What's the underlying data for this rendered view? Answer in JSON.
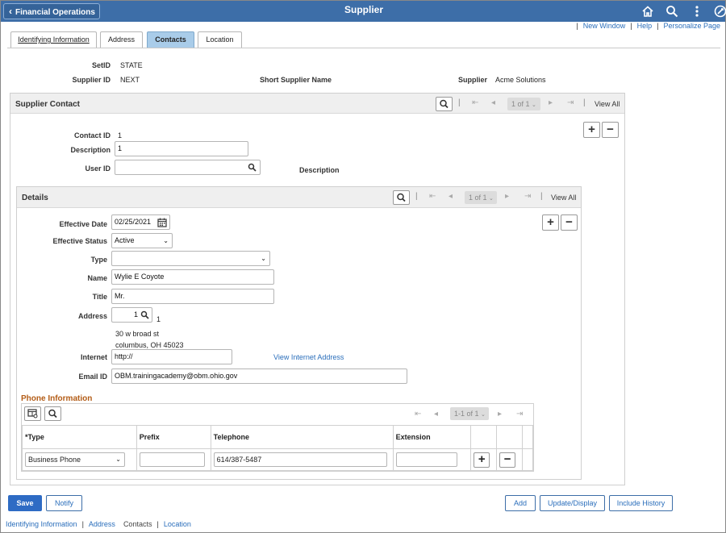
{
  "header": {
    "back_label": "Financial Operations",
    "title": "Supplier",
    "icons": [
      "home-icon",
      "search-icon",
      "more-icon",
      "navbar-icon"
    ]
  },
  "top_links": {
    "new_window": "New Window",
    "help": "Help",
    "personalize": "Personalize Page"
  },
  "tabs": [
    {
      "label": "Identifying Information",
      "active": false
    },
    {
      "label": "Address",
      "active": false
    },
    {
      "label": "Contacts",
      "active": true
    },
    {
      "label": "Location",
      "active": false
    }
  ],
  "summary": {
    "setid_label": "SetID",
    "setid_value": "STATE",
    "supplier_id_label": "Supplier ID",
    "supplier_id_value": "NEXT",
    "short_name_label": "Short Supplier Name",
    "supplier_label": "Supplier",
    "supplier_value": "Acme Solutions"
  },
  "supplier_contact": {
    "title": "Supplier Contact",
    "pager": "1 of 1",
    "view_all": "View All",
    "contact_id_label": "Contact ID",
    "contact_id_value": "1",
    "description_label": "Description",
    "description_value": "1",
    "user_id_label": "User ID",
    "user_id_value": "",
    "user_desc_label": "Description"
  },
  "details": {
    "title": "Details",
    "pager": "1 of 1",
    "view_all": "View All",
    "effective_date_label": "Effective Date",
    "effective_date_value": "02/25/2021",
    "effective_status_label": "Effective Status",
    "effective_status_value": "Active",
    "type_label": "Type",
    "type_value": "",
    "name_label": "Name",
    "name_value": "Wylie E Coyote",
    "title_label": "Title",
    "title_value": "Mr.",
    "address_label": "Address",
    "address_value": "1",
    "address_seq": "1",
    "address_line1": "30 w broad st",
    "address_line2": "columbus, OH  45023",
    "internet_label": "Internet",
    "internet_value": "http://",
    "view_internet": "View Internet Address",
    "email_label": "Email ID",
    "email_value": "OBM.trainingacademy@obm.ohio.gov"
  },
  "phone": {
    "title": "Phone Information",
    "pager": "1-1 of 1",
    "columns": {
      "type": "*Type",
      "prefix": "Prefix",
      "telephone": "Telephone",
      "extension": "Extension"
    },
    "rows": [
      {
        "type": "Business Phone",
        "prefix": "",
        "telephone": "614/387-5487",
        "extension": ""
      }
    ]
  },
  "footer_buttons": {
    "save": "Save",
    "notify": "Notify",
    "add": "Add",
    "update_display": "Update/Display",
    "include_history": "Include History"
  },
  "footer_links": [
    "Identifying Information",
    "Address",
    "Contacts",
    "Location"
  ]
}
